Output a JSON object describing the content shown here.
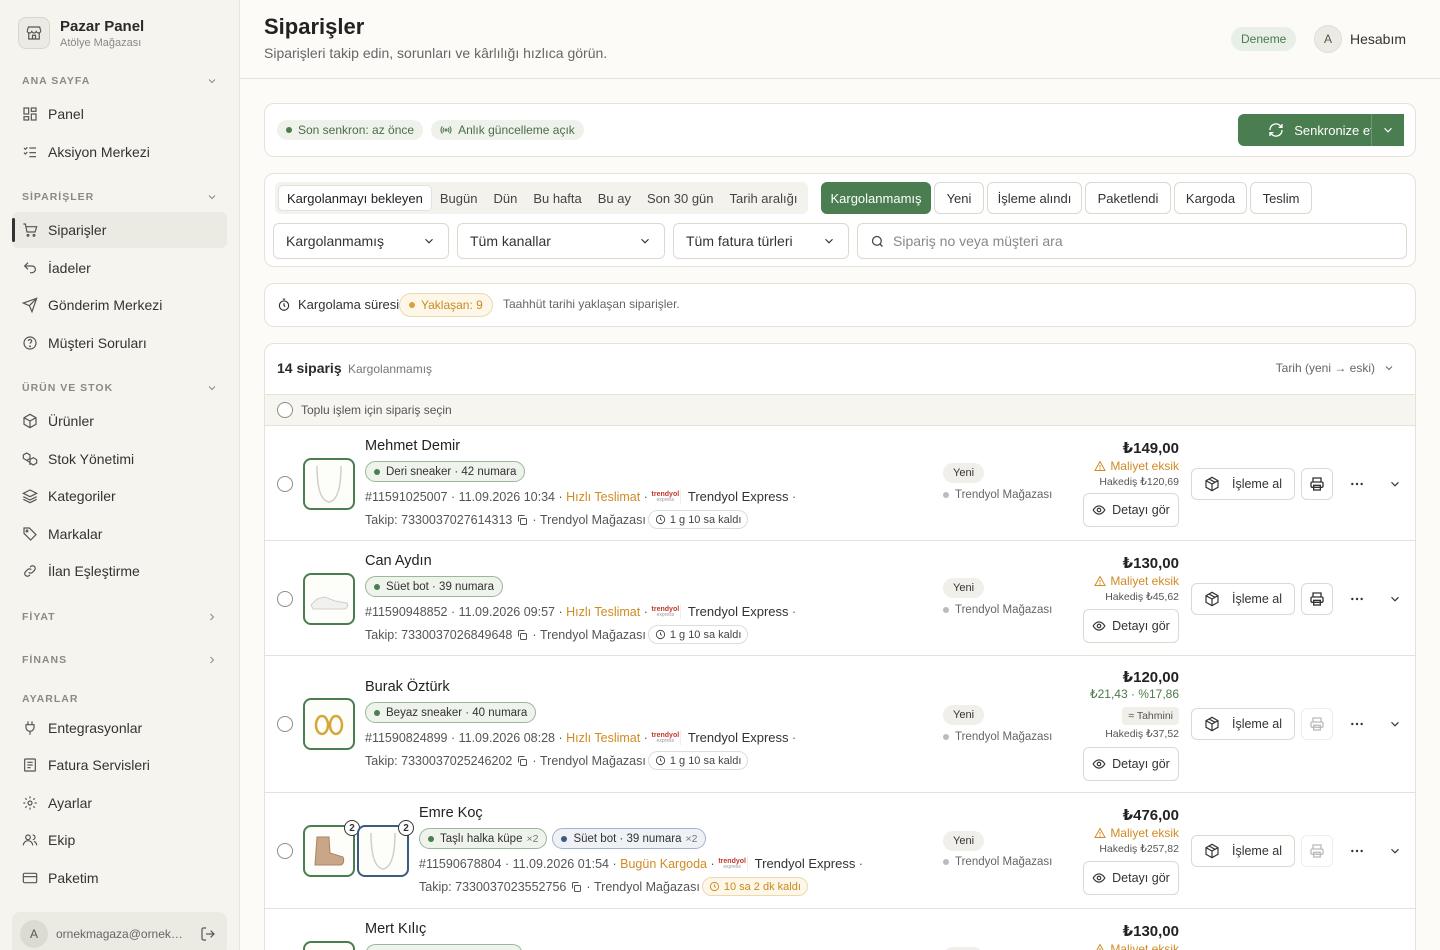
{
  "brand": {
    "name": "Pazar Panel",
    "store": "Atölye Mağazası"
  },
  "sidebar": {
    "sections": [
      {
        "label": "ANA SAYFA"
      },
      {
        "label": "SİPARİŞLER"
      },
      {
        "label": "ÜRÜN VE STOK"
      },
      {
        "label": "FİYAT"
      },
      {
        "label": "FİNANS"
      },
      {
        "label": "AYARLAR"
      }
    ],
    "items": [
      {
        "label": "Panel",
        "icon": "dashboard-icon"
      },
      {
        "label": "Aksiyon Merkezi",
        "icon": "list-check-icon"
      },
      {
        "label": "Siparişler",
        "icon": "cart-icon"
      },
      {
        "label": "İadeler",
        "icon": "undo-icon"
      },
      {
        "label": "Gönderim Merkezi",
        "icon": "send-icon"
      },
      {
        "label": "Müşteri Soruları",
        "icon": "help-icon"
      },
      {
        "label": "Ürünler",
        "icon": "box-icon"
      },
      {
        "label": "Stok Yönetimi",
        "icon": "boxes-icon"
      },
      {
        "label": "Kategoriler",
        "icon": "layers-icon"
      },
      {
        "label": "Markalar",
        "icon": "tag-icon"
      },
      {
        "label": "İlan Eşleştirme",
        "icon": "link-icon"
      },
      {
        "label": "Entegrasyonlar",
        "icon": "plug-icon"
      },
      {
        "label": "Fatura Servisleri",
        "icon": "invoice-icon"
      },
      {
        "label": "Ayarlar",
        "icon": "gear-icon"
      },
      {
        "label": "Ekip",
        "icon": "team-icon"
      },
      {
        "label": "Paketim",
        "icon": "card-icon"
      }
    ],
    "user_email": "ornekmagaza@ornek.com",
    "user_initial": "A"
  },
  "header": {
    "title": "Siparişler",
    "subtitle": "Siparişleri takip edin, sorunları ve kârlılığı hızlıca görün.",
    "badge": "Deneme",
    "account_initial": "A",
    "account_label": "Hesabım"
  },
  "sync": {
    "last_sync": "Son senkron: az önce",
    "live": "Anlık güncelleme açık",
    "button": "Senkronize et"
  },
  "filters": {
    "date_tabs": [
      "Kargolanmayı bekleyen",
      "Bugün",
      "Dün",
      "Bu hafta",
      "Bu ay",
      "Son 30 gün",
      "Tarih aralığı"
    ],
    "status_tabs": [
      "Kargolanmamış",
      "Yeni",
      "İşleme alındı",
      "Paketlendi",
      "Kargoda",
      "Teslim"
    ],
    "status_select": "Kargolanmamış",
    "channel_select": "Tüm kanallar",
    "invoice_select": "Tüm fatura türleri",
    "search_placeholder": "Sipariş no veya müşteri ara"
  },
  "cargo": {
    "label": "Kargolama süresi",
    "badge": "Yaklaşan: 9",
    "note": "Taahhüt tarihi yaklaşan siparişler."
  },
  "list": {
    "count": "14 sipariş",
    "filter": "Kargolanmamış",
    "sort": "Tarih (yeni → eski)",
    "bulk": "Toplu işlem için sipariş seçin"
  },
  "labels": {
    "detail": "Detayı gör",
    "process": "İşleme al",
    "carrier": "Trendyol Express",
    "store": "Trendyol Mağazası",
    "status": "Yeni",
    "cost_missing": "Maliyet eksik",
    "estimated": "≈ Tahmini",
    "logo_text": "trendyol",
    "logo_sub": "express"
  },
  "orders": [
    {
      "customer": "Mehmet Demir",
      "products": [
        {
          "name": "Deri sneaker · 42 numara",
          "qty": ""
        }
      ],
      "meta": "#11591025007 · 11.09.2026 10:34 ·",
      "delivery": "Hızlı Teslimat",
      "tracking": "Takip: 7330037027614313",
      "time_left": "1 g 10 sa kaldı",
      "price": "₺149,00",
      "hakedis": "Hakediş ₺120,69"
    },
    {
      "customer": "Can Aydın",
      "products": [
        {
          "name": "Süet bot · 39 numara",
          "qty": ""
        }
      ],
      "meta": "#11590948852 · 11.09.2026 09:57 ·",
      "delivery": "Hızlı Teslimat",
      "tracking": "Takip: 7330037026849648",
      "time_left": "1 g 10 sa kaldı",
      "price": "₺130,00",
      "hakedis": "Hakediş ₺45,62"
    },
    {
      "customer": "Burak Öztürk",
      "products": [
        {
          "name": "Beyaz sneaker · 40 numara",
          "qty": ""
        }
      ],
      "meta": "#11590824899 · 11.09.2026 08:28 ·",
      "delivery": "Hızlı Teslimat",
      "tracking": "Takip: 7330037025246202",
      "time_left": "1 g 10 sa kaldı",
      "price": "₺120,00",
      "cost": "₺21,43 · %17,86",
      "hakedis": "Hakediş ₺37,52"
    },
    {
      "customer": "Emre Koç",
      "products": [
        {
          "name": "Taşlı halka küpe",
          "qty": "×2"
        },
        {
          "name": "Süet bot · 39 numara",
          "qty": "×2"
        }
      ],
      "thumb_qty": [
        "2",
        "2"
      ],
      "meta": "#11590678804 · 11.09.2026 01:54 ·",
      "delivery": "Bugün Kargoda",
      "tracking": "Takip: 7330037023552756",
      "time_left": "10 sa 2 dk kaldı",
      "price": "₺476,00",
      "hakedis": "Hakediş ₺257,82"
    },
    {
      "customer": "Mert Kılıç",
      "price": "₺130,00"
    }
  ]
}
